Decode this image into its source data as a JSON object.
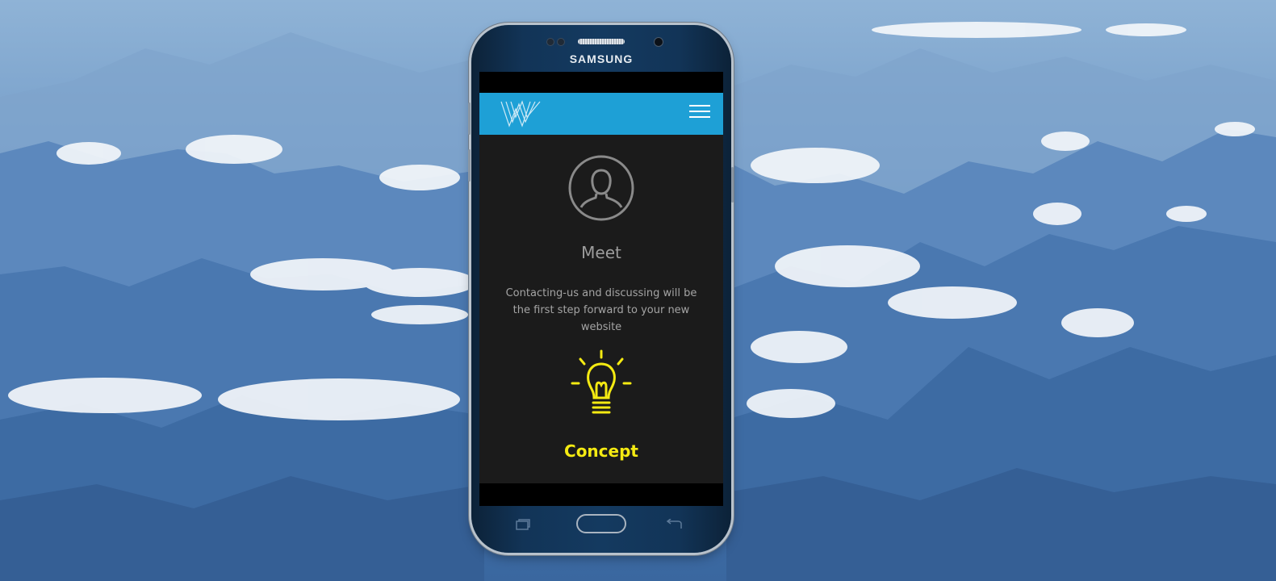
{
  "phone": {
    "brand": "SAMSUNG"
  },
  "site": {
    "logo_icon": "w-logo-icon",
    "menu_icon": "hamburger-menu-icon"
  },
  "sections": [
    {
      "icon": "user-avatar-icon",
      "title": "Meet",
      "description": "Contacting-us and discussing will be the first step forward to your new website"
    },
    {
      "icon": "lightbulb-icon",
      "title": "Concept"
    }
  ],
  "colors": {
    "header_bg": "#1ea0d6",
    "content_bg": "#1b1b1b",
    "concept_accent": "#f4ea12",
    "muted_text": "#9c9c9c"
  }
}
